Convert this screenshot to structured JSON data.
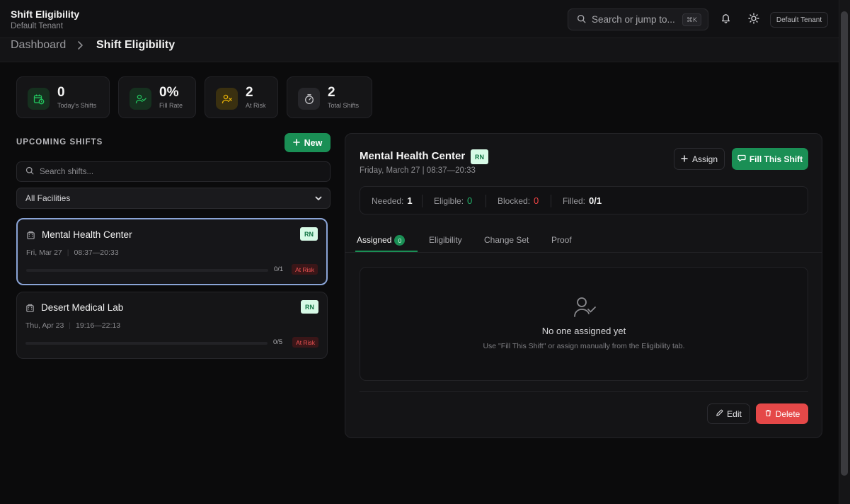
{
  "header": {
    "title": "Shift Eligibility",
    "subtitle": "Default Tenant",
    "search_placeholder": "Search or jump to...",
    "search_shortcut": "⌘K",
    "tenant_label": "Default Tenant",
    "icons": [
      "bell-icon",
      "sun-icon"
    ]
  },
  "breadcrumb": {
    "home": "Dashboard",
    "current": "Shift Eligibility"
  },
  "stats": [
    {
      "value": "0",
      "label": "Today's Shifts",
      "icon": "calendar-clock-icon",
      "color": "#22c55e"
    },
    {
      "value": "0%",
      "label": "Fill Rate",
      "icon": "user-check-icon",
      "color": "#22c55e"
    },
    {
      "value": "2",
      "label": "At Risk",
      "icon": "user-x-icon",
      "color": "#eab308"
    },
    {
      "value": "2",
      "label": "Total Shifts",
      "icon": "timer-icon",
      "color": "#a1a1aa"
    }
  ],
  "shifts_panel": {
    "title": "UPCOMING SHIFTS",
    "new_label": "New",
    "search_placeholder": "Search shifts...",
    "facility_filter": "All Facilities"
  },
  "shifts": [
    {
      "name": "Mental Health Center",
      "date": "Fri, Mar 27",
      "time": "08:37—20:33",
      "role": "RN",
      "filled": "0/1",
      "fill_fraction": 0,
      "status": "At Risk",
      "selected": true
    },
    {
      "name": "Desert Medical Lab",
      "date": "Thu, Apr 23",
      "time": "19:16—22:13",
      "role": "RN",
      "filled": "0/5",
      "fill_fraction": 0,
      "status": "At Risk",
      "selected": false
    }
  ],
  "detail": {
    "title": "Mental Health Center",
    "role": "RN",
    "datetime": "Friday, March 27 | 08:37—20:33",
    "assign_label": "Assign",
    "fill_label": "Fill This Shift",
    "metrics": {
      "needed_label": "Needed:",
      "needed": "1",
      "eligible_label": "Eligible:",
      "eligible": "0",
      "blocked_label": "Blocked:",
      "blocked": "0",
      "filled_label": "Filled:",
      "filled": "0/1"
    },
    "tabs": [
      {
        "label": "Assigned",
        "count": "0",
        "active": true
      },
      {
        "label": "Eligibility"
      },
      {
        "label": "Change Set"
      },
      {
        "label": "Proof"
      }
    ],
    "empty_title": "No one assigned yet",
    "empty_sub": "Use \"Fill This Shift\" or assign manually from the Eligibility tab.",
    "edit_label": "Edit",
    "delete_label": "Delete"
  },
  "colors": {
    "accent": "#1a8f55",
    "danger": "#e54848",
    "warning": "#eab308",
    "selected_border": "#8aa4d6"
  }
}
